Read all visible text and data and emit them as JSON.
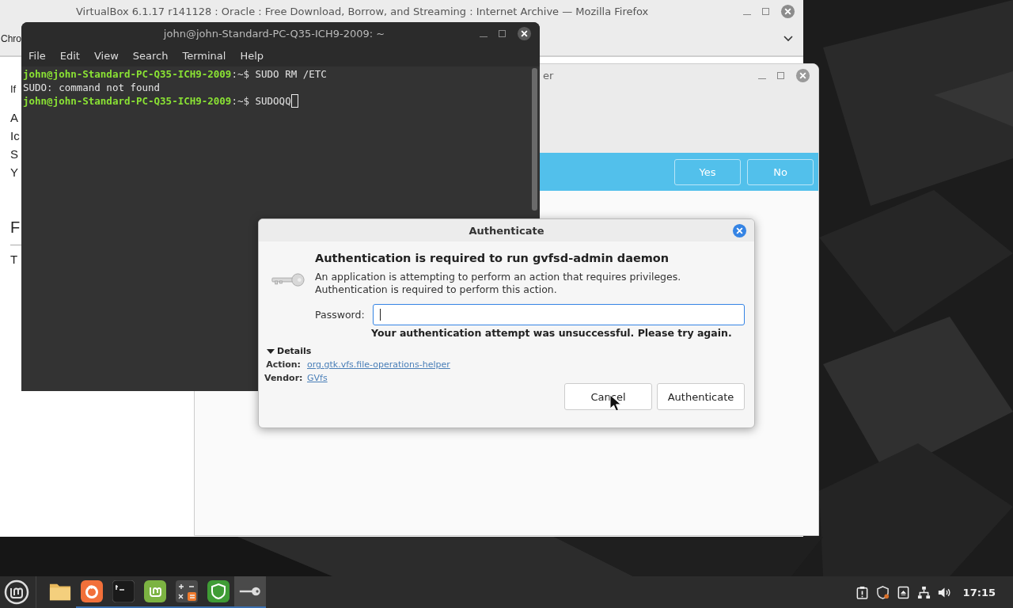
{
  "browser_window": {
    "title": "VirtualBox 6.1.17 r141128 : Oracle : Free Download, Borrow, and Streaming : Internet Archive — Mozilla Firefox",
    "tab_fragment": "Chro",
    "page_fragments": [
      {
        "kind": "small",
        "text": "If"
      },
      {
        "kind": "body",
        "text": "A"
      },
      {
        "kind": "body",
        "text": "Ic"
      },
      {
        "kind": "body",
        "text": "S"
      },
      {
        "kind": "body",
        "text": "Y"
      },
      {
        "kind": "heading",
        "text": "F"
      },
      {
        "kind": "body",
        "text": "T"
      }
    ]
  },
  "dialog_window": {
    "title_fragment": "er",
    "buttons": [
      "Yes",
      "No"
    ]
  },
  "terminal": {
    "title": "john@john-Standard-PC-Q35-ICH9-2009: ~",
    "menu": [
      "File",
      "Edit",
      "View",
      "Search",
      "Terminal",
      "Help"
    ],
    "lines": [
      {
        "kind": "prompt",
        "user": "john@john-Standard-PC-Q35-ICH9-2009",
        "path": ":~$ ",
        "command": "SUDO RM /ETC",
        "cursor": false
      },
      {
        "kind": "output",
        "text": "SUDO: command not found"
      },
      {
        "kind": "prompt",
        "user": "john@john-Standard-PC-Q35-ICH9-2009",
        "path": ":~$ ",
        "command": "SUDOQQ",
        "cursor": true
      }
    ]
  },
  "auth_dialog": {
    "title": "Authenticate",
    "heading": "Authentication is required to run gvfsd-admin daemon",
    "message": "An application is attempting to perform an action that requires privileges. Authentication is required to perform this action.",
    "password_label": "Password:",
    "error": "Your authentication attempt was unsuccessful. Please try again.",
    "details_label": "Details",
    "details_expanded": true,
    "details": [
      {
        "label": "Action:",
        "value": "org.gtk.vfs.file-operations-helper"
      },
      {
        "label": "Vendor:",
        "value": "GVfs"
      }
    ],
    "buttons": [
      "Cancel",
      "Authenticate"
    ]
  },
  "taskbar": {
    "apps": [
      {
        "kind": "files",
        "running": false,
        "focused": false
      },
      {
        "kind": "firefox",
        "running": true,
        "focused": false
      },
      {
        "kind": "terminal",
        "running": true,
        "focused": false
      },
      {
        "kind": "mint",
        "running": true,
        "focused": false
      },
      {
        "kind": "calculator",
        "running": true,
        "focused": false
      },
      {
        "kind": "shield",
        "running": true,
        "focused": false
      },
      {
        "kind": "key",
        "running": true,
        "focused": true
      }
    ],
    "clock": "17:15"
  }
}
